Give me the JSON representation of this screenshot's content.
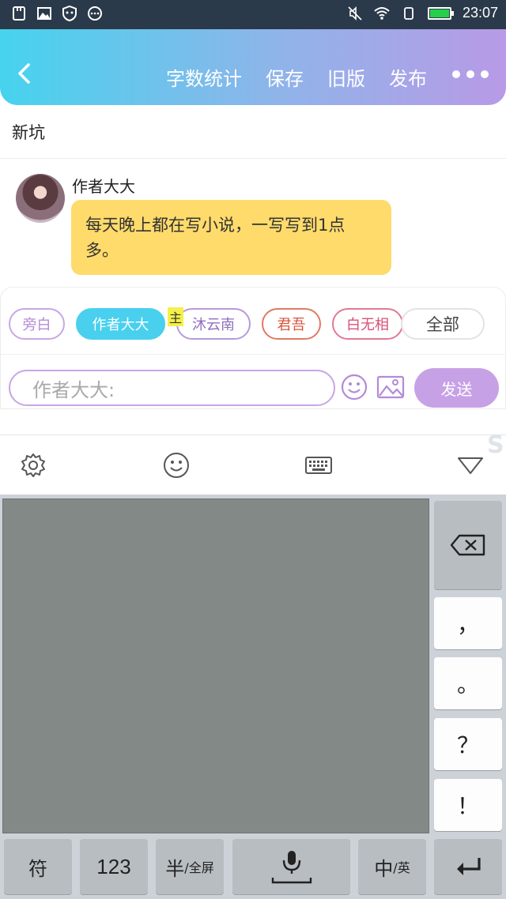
{
  "status_bar": {
    "time": "23:07",
    "left_icons": [
      "sim-card-icon",
      "image-icon",
      "shield-icon",
      "more-circle-icon"
    ],
    "right_icons": [
      "mute-icon",
      "wifi-icon",
      "portrait-lock-icon",
      "battery-icon"
    ]
  },
  "header": {
    "back_icon": "chevron-left-icon",
    "actions": [
      "字数统计",
      "保存",
      "旧版",
      "发布"
    ],
    "more_icon": "more-dots-icon",
    "gradient": [
      "#46d3ee",
      "#b89ae6"
    ]
  },
  "novel": {
    "title": "新坑"
  },
  "message": {
    "author": "作者大大",
    "text": "每天晚上都在写小说，一写写到1点多。",
    "bubble_color": "#fedb6b"
  },
  "composer": {
    "roles": [
      "旁白",
      "作者大大",
      "沐云南",
      "君吾",
      "白无相",
      "全部"
    ],
    "selected_role": "作者大大",
    "main_badge": "主",
    "input_placeholder": "作者大大:",
    "send_label": "发送",
    "accent": "#48d0ee",
    "send_color": "#c7a1e6"
  },
  "keyboard": {
    "toolbar_icons": [
      "settings-icon",
      "emoji-icon",
      "keyboard-icon",
      "collapse-icon"
    ],
    "side_keys": [
      "，",
      "。",
      "？",
      "！"
    ],
    "bottom_keys": {
      "symbol": "符",
      "number": "123",
      "half": "半",
      "half_sub": "/全屏",
      "lang": "中",
      "lang_sub": "/英"
    }
  }
}
